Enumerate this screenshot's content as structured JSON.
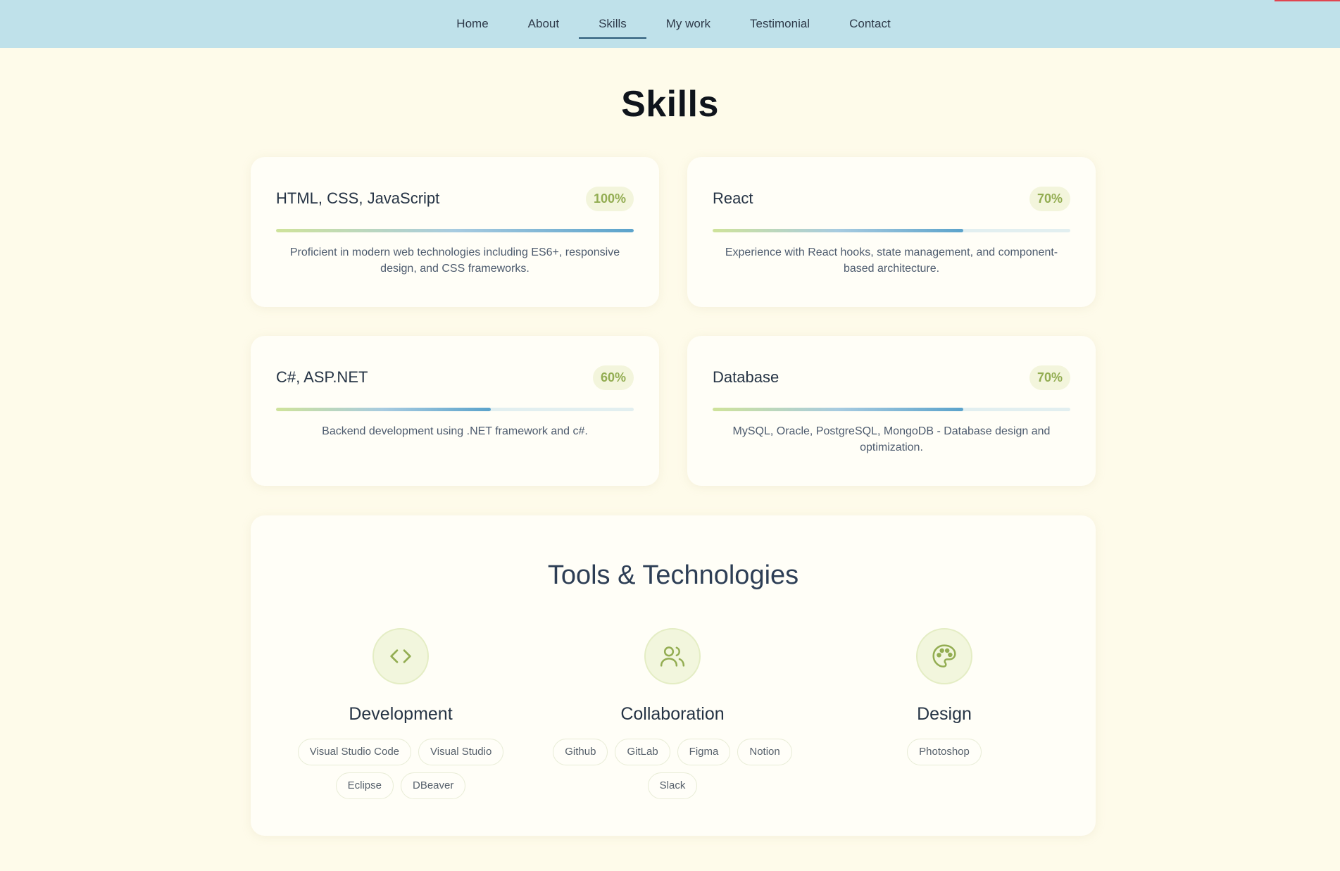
{
  "nav": {
    "items": [
      {
        "label": "Home"
      },
      {
        "label": "About"
      },
      {
        "label": "Skills"
      },
      {
        "label": "My work"
      },
      {
        "label": "Testimonial"
      },
      {
        "label": "Contact"
      }
    ],
    "active": "Skills"
  },
  "page": {
    "title": "Skills"
  },
  "skills": [
    {
      "name": "HTML, CSS, JavaScript",
      "percent_label": "100%",
      "level": 1.0,
      "description": "Proficient in modern web technologies including ES6+, responsive design, and CSS frameworks."
    },
    {
      "name": "React",
      "percent_label": "70%",
      "level": 0.7,
      "description": "Experience with React hooks, state management, and component-based architecture."
    },
    {
      "name": "C#, ASP.NET",
      "percent_label": "60%",
      "level": 0.6,
      "description": "Backend development using .NET framework and c#."
    },
    {
      "name": "Database",
      "percent_label": "70%",
      "level": 0.7,
      "description": "MySQL, Oracle, PostgreSQL, MongoDB - Database design and optimization."
    }
  ],
  "tools": {
    "title": "Tools & Technologies",
    "categories": [
      {
        "heading": "Development",
        "icon": "code-icon",
        "tags": [
          "Visual Studio Code",
          "Visual Studio",
          "Eclipse",
          "DBeaver"
        ]
      },
      {
        "heading": "Collaboration",
        "icon": "users-icon",
        "tags": [
          "Github",
          "GitLab",
          "Figma",
          "Notion",
          "Slack"
        ]
      },
      {
        "heading": "Design",
        "icon": "palette-icon",
        "tags": [
          "Photoshop"
        ]
      }
    ]
  },
  "colors": {
    "nav_bg": "#bfe1ea",
    "page_bg": "#fefbea",
    "accent_green": "#93ad52",
    "accent_blue": "#5ba3cb"
  }
}
